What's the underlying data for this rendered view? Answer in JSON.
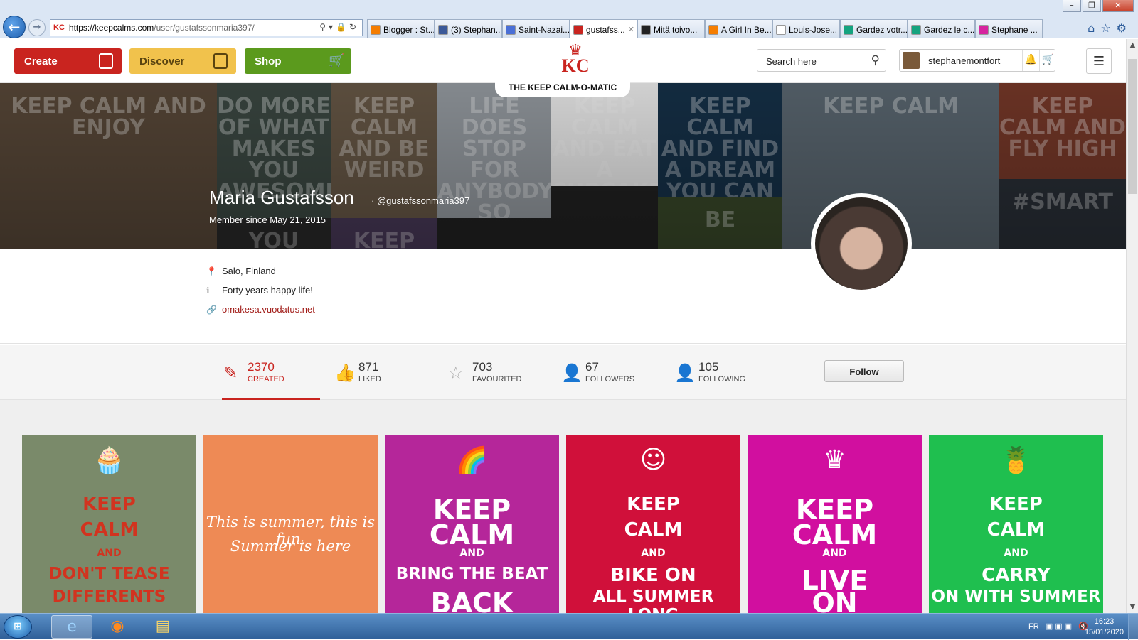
{
  "browser": {
    "url_host": "https://keepcalms.com",
    "url_path": "/user/gustafssonmaria397/",
    "tabs": [
      {
        "label": "Blogger : St...",
        "color": "#f57d00"
      },
      {
        "label": "(3) Stephan...",
        "color": "#3b5998"
      },
      {
        "label": "Saint-Nazai...",
        "color": "#4a6fd6"
      },
      {
        "label": "gustafss...",
        "color": "#c9241f",
        "active": true
      },
      {
        "label": "Mitä toivo...",
        "color": "#222222"
      },
      {
        "label": "A Girl In Be...",
        "color": "#f57d00"
      },
      {
        "label": "Louis-Jose...",
        "color": "#ffffff"
      },
      {
        "label": "Gardez votr...",
        "color": "#14a37f"
      },
      {
        "label": "Gardez le c...",
        "color": "#14a37f"
      },
      {
        "label": "Stephane ...",
        "color": "#d6249f"
      }
    ],
    "window_buttons": [
      "–",
      "❐",
      "✕"
    ]
  },
  "header": {
    "create_label": "Create",
    "discover_label": "Discover",
    "shop_label": "Shop",
    "logo_text": "KC",
    "logo_tagline": "THE KEEP CALM-O-MATIC",
    "search_placeholder": "Search here",
    "username": "stephanemontfort",
    "colors": {
      "create": "#c9241f",
      "discover": "#f1c24c",
      "shop": "#5b9a1d"
    }
  },
  "cover": {
    "tiles": [
      {
        "text": "KEEP CALM AND ENJOY",
        "bg": "#5b4a3a"
      },
      {
        "text": "DO MORE OF WHAT MAKES YOU AWESOME",
        "bg": "#3d4a44"
      },
      {
        "text": "KEEP CALM AND BE WEIRD",
        "bg": "#6a5a48"
      },
      {
        "text": "LIFE DOES STOP FOR ANYBODY SO CARRY ON",
        "bg": "#9aa0a6"
      },
      {
        "text": "KEEP CALM AND EAT A CUPCAKE",
        "bg": "#f4f4f4"
      },
      {
        "text": "KEEP CALM AND FIND A DREAM YOU CAN FOLLOW",
        "bg": "#16324a"
      },
      {
        "text": "KEEP CALM",
        "bg": "#5d6a74"
      },
      {
        "text": "KEEP CALM AND FLY HIGH",
        "bg": "#7a3a2a"
      },
      {
        "text": "#SMART",
        "bg": "#2a3038"
      },
      {
        "text": "YOU wanna",
        "bg": "#2a2a2a"
      },
      {
        "text": "KEEP",
        "bg": "#4a3a5a"
      },
      {
        "text": "BE",
        "bg": "#3a4a2a"
      }
    ]
  },
  "profile": {
    "name": "Maria Gustafsson",
    "handle": "@gustafssonmaria397",
    "member_since": "Member since May 21, 2015",
    "location": "Salo, Finland",
    "bio": "Forty years happy life!",
    "website": "omakesa.vuodatus.net"
  },
  "stats": {
    "created": {
      "count": "2370",
      "label": "CREATED"
    },
    "liked": {
      "count": "871",
      "label": "LIKED"
    },
    "favourited": {
      "count": "703",
      "label": "FAVOURITED"
    },
    "followers": {
      "count": "67",
      "label": "FOLLOWERS"
    },
    "following": {
      "count": "105",
      "label": "FOLLOWING"
    },
    "follow_label": "Follow"
  },
  "posters": [
    {
      "lines": [
        "KEEP",
        "CALM",
        "AND",
        "DON'T TEASE",
        "DIFFERENTS"
      ],
      "bg": "#7a8a6a",
      "fg": "#d2331f",
      "icon": "cupcake-icon"
    },
    {
      "lines": [
        "This is summer, this is fun.",
        "Summer is here"
      ],
      "bg": "#ee8a55",
      "fg": "#ffffff",
      "icon": ""
    },
    {
      "lines": [
        "KEEP",
        "CALM",
        "AND",
        "BRING THE BEAT",
        "BACK"
      ],
      "bg": "#b5269a",
      "fg": "#ffffff",
      "icon": "rainbow-icon"
    },
    {
      "lines": [
        "KEEP",
        "CALM",
        "AND",
        "BIKE ON",
        "ALL SUMMER LONG"
      ],
      "bg": "#d0103a",
      "fg": "#ffffff",
      "icon": "smiley-icon"
    },
    {
      "lines": [
        "KEEP",
        "CALM",
        "AND",
        "LIVE",
        "ON"
      ],
      "bg": "#d10f9f",
      "fg": "#ffffff",
      "icon": "crown-icon"
    },
    {
      "lines": [
        "KEEP",
        "CALM",
        "AND",
        "CARRY",
        "ON WITH SUMMER"
      ],
      "bg": "#1fbf4f",
      "fg": "#ffffff",
      "icon": "pineapple-icon"
    }
  ],
  "taskbar": {
    "lang": "FR",
    "time": "16:23",
    "date": "15/01/2020"
  }
}
